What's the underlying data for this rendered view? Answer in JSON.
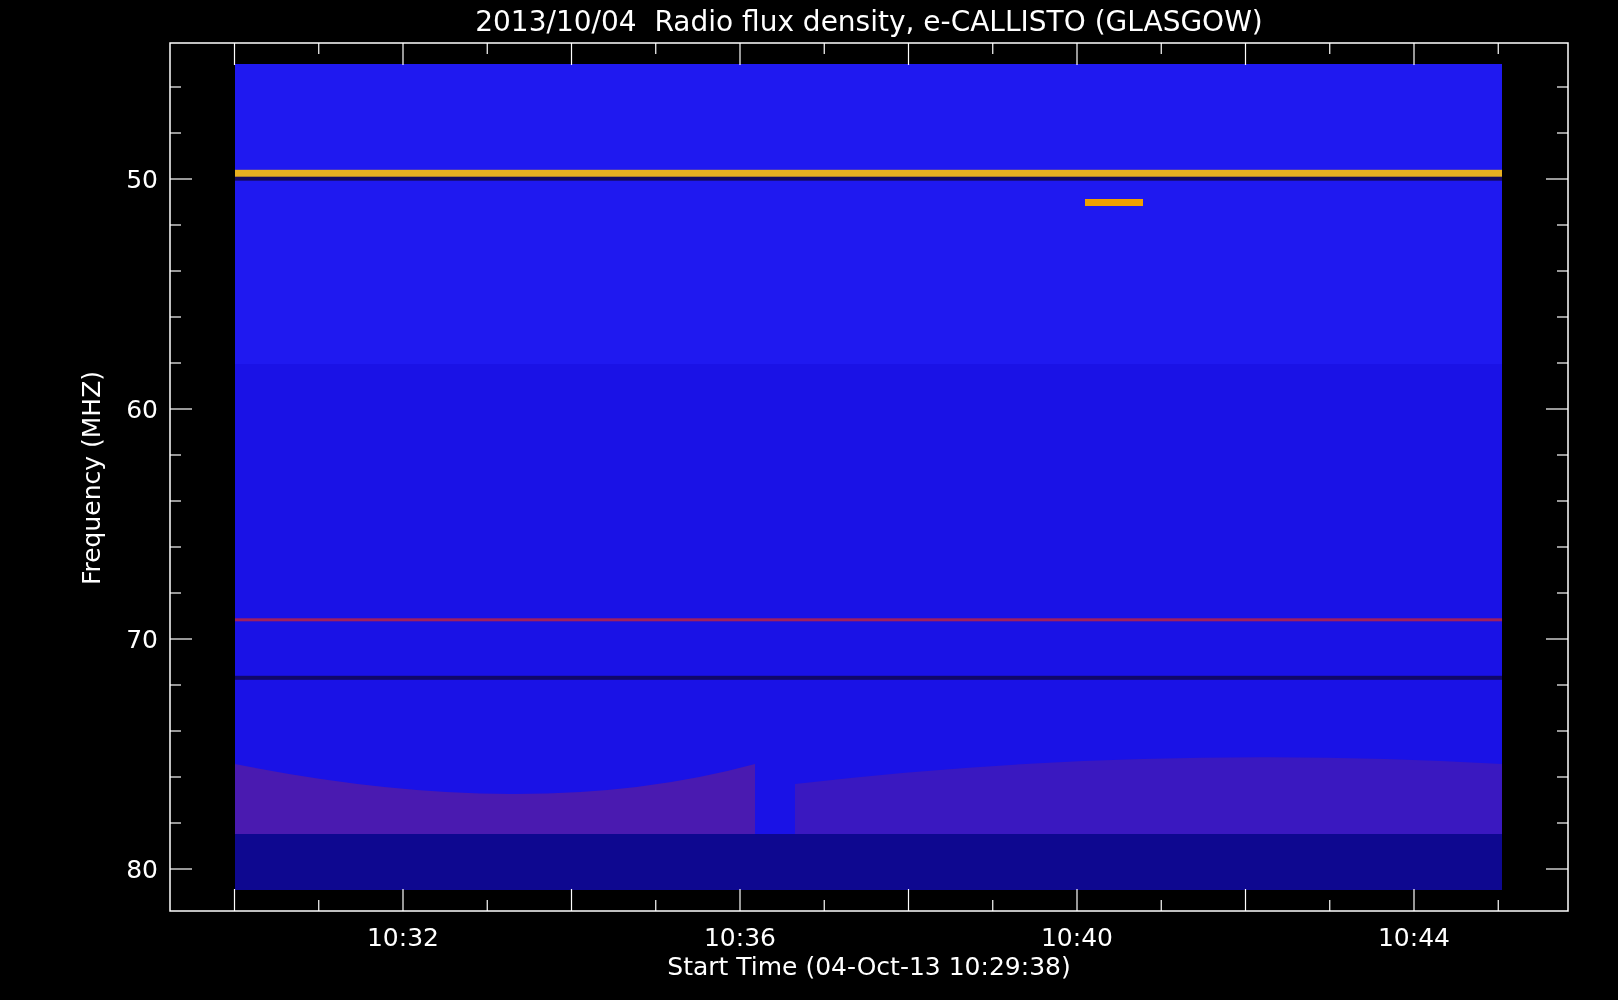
{
  "plot": {
    "title": "2013/10/04  Radio flux density, e-CALLISTO (GLASGOW)",
    "ylabel": "Frequency (MHZ)",
    "xlabel": "Start Time (04-Oct-13 10:29:38)",
    "yticks": [
      "50",
      "60",
      "70",
      "80"
    ],
    "xticks": [
      "10:32",
      "10:36",
      "10:40",
      "10:44"
    ]
  }
}
